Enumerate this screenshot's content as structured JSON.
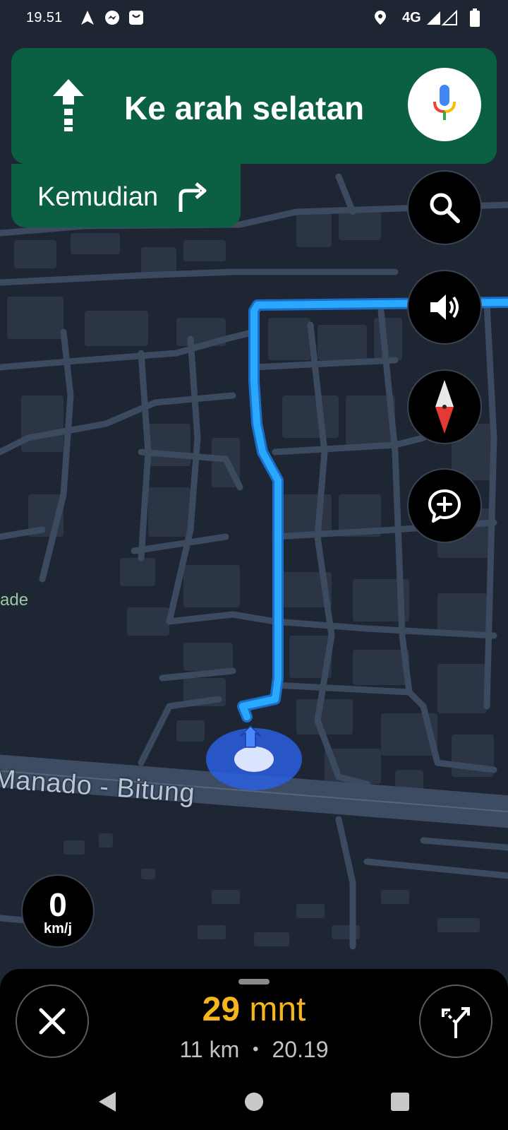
{
  "status_bar": {
    "time": "19.51",
    "network": "4G",
    "icons": [
      "navigation-arrow-icon",
      "messenger-icon",
      "shopping-bag-icon",
      "location-pin-icon",
      "signal-icon",
      "battery-icon"
    ]
  },
  "navigation": {
    "direction_text": "Ke arah selatan",
    "then_label": "Kemudian",
    "direction_icon": "straight-arrow-icon",
    "then_icon": "turn-right-icon",
    "voice_icon": "google-mic-icon"
  },
  "map_controls": [
    "search-icon",
    "volume-icon",
    "compass-icon",
    "add-report-icon"
  ],
  "map": {
    "place_label": "ade",
    "road_label": "Manado - Bitung",
    "route_color": "#2aa8ff"
  },
  "speedometer": {
    "value": "0",
    "unit": "km/j"
  },
  "trip": {
    "eta_value": "29",
    "eta_unit": "mnt",
    "distance": "11 km",
    "separator": "•",
    "arrival_time": "20.19",
    "eta_color": "#f6b51e"
  },
  "colors": {
    "banner": "#0b5f42",
    "map_bg": "#1e2533",
    "road": "#3b4a5e"
  }
}
